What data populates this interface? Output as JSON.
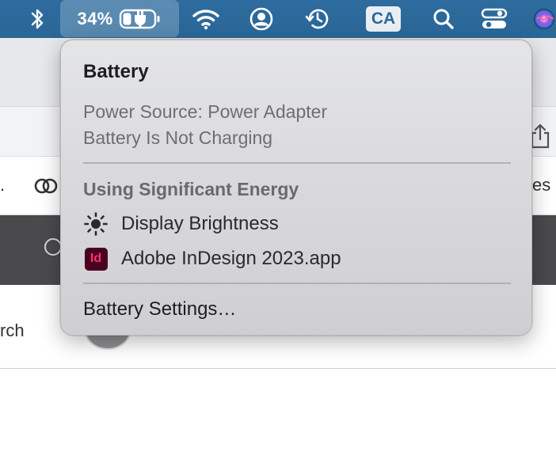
{
  "menubar": {
    "battery_percent": "34%",
    "input_source": "CA",
    "icons": [
      "bluetooth-icon",
      "battery-charging-icon",
      "wifi-icon",
      "user-account-icon",
      "time-machine-icon",
      "spotlight-search-icon",
      "control-center-icon",
      "siri-icon"
    ]
  },
  "background": {
    "left_fragment": ".",
    "right_fragment": "es",
    "row_fragment": "rch"
  },
  "battery_menu": {
    "title": "Battery",
    "power_source": "Power Source: Power Adapter",
    "charging_status": "Battery Is Not Charging",
    "section_heading": "Using Significant Energy",
    "apps": [
      {
        "label": "Display Brightness",
        "icon": "brightness-icon"
      },
      {
        "label": "Adobe InDesign 2023.app",
        "icon": "indesign-app-icon",
        "icon_text": "Id"
      }
    ],
    "settings_label": "Battery Settings…"
  },
  "colors": {
    "menubar": "#2a6798",
    "indesign_bg": "#49021f",
    "indesign_fg": "#ff3366"
  }
}
